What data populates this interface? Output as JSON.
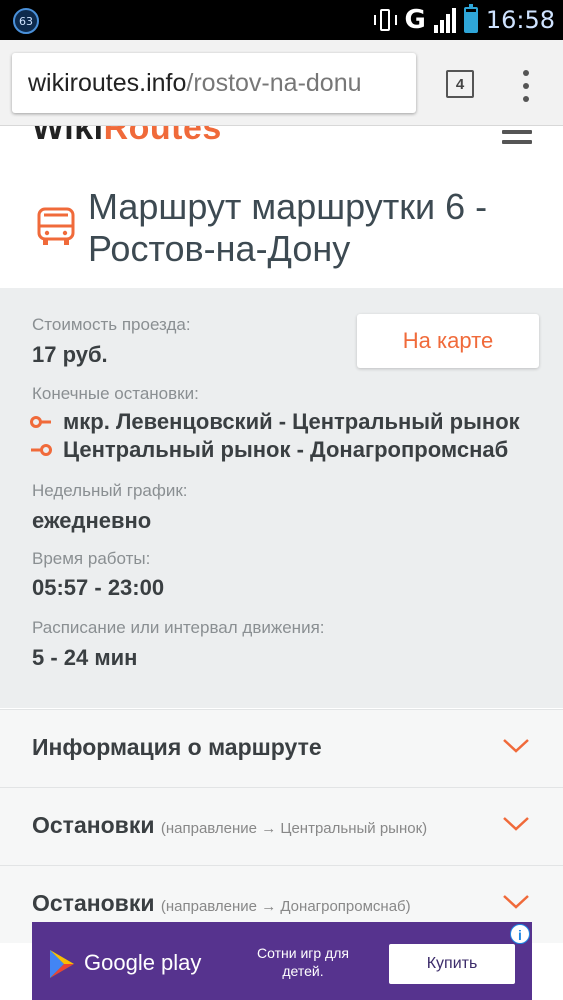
{
  "status_bar": {
    "badge": "63",
    "network": "G",
    "time": "16:58",
    "battery_level": 0.85
  },
  "browser": {
    "url_host": "wikiroutes.info",
    "url_path": "/rostov-na-donu",
    "tab_count": "4"
  },
  "site": {
    "logo_part1": "Wiki",
    "logo_part2": "Routes"
  },
  "route": {
    "title": "Маршрут маршрутки 6 - Ростов-на-Дону"
  },
  "info": {
    "fare_label": "Стоимость проезда:",
    "fare_value": "17 руб.",
    "map_button": "На карте",
    "terminals_label": "Конечные остановки:",
    "terminal_1": "мкр. Левенцовский - Центральный рынок",
    "terminal_2": "Центральный рынок - Донагропромснаб",
    "schedule_label": "Недельный график:",
    "schedule_value": "ежедневно",
    "hours_label": "Время работы:",
    "hours_value": "05:57 - 23:00",
    "interval_label": "Расписание или интервал движения:",
    "interval_value": "5 - 24 мин"
  },
  "accordions": [
    {
      "title": "Информация о маршруте",
      "sub_prefix": "",
      "sub_target": ""
    },
    {
      "title": "Остановки",
      "sub_prefix": "(направление",
      "sub_target": "Центральный рынок)"
    },
    {
      "title": "Остановки",
      "sub_prefix": "(направление",
      "sub_target": "Донагропромснаб)"
    }
  ],
  "ad": {
    "brand": "Google play",
    "text": "Сотни игр для детей.",
    "button": "Купить",
    "info_icon": "i"
  },
  "colors": {
    "accent": "#f06a3a",
    "panel_bg": "#eceeef",
    "ad_bg": "#56338e"
  },
  "icons": {
    "title": "bus-icon",
    "terminal_start": "route-start-icon",
    "terminal_end": "route-end-icon",
    "accordion": "chevron-down-icon"
  }
}
